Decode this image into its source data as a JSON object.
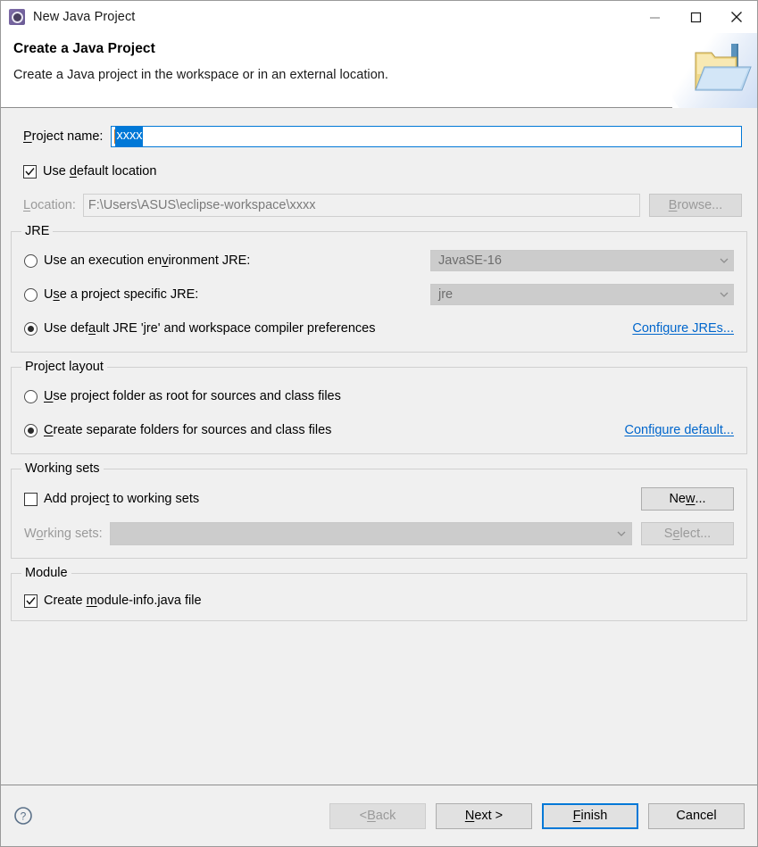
{
  "window": {
    "title": "New Java Project",
    "icon": "eclipse-wizard-icon",
    "minimize_label": "Minimize",
    "maximize_label": "Maximize",
    "close_label": "Close"
  },
  "header": {
    "title": "Create a Java Project",
    "description": "Create a Java project in the workspace or in an external location.",
    "banner_icon": "java-project-folder-icon"
  },
  "project_name": {
    "label": "Project name:",
    "value": "xxxx",
    "selected": true
  },
  "location": {
    "use_default_label": "Use default location",
    "use_default_checked": true,
    "label": "Location:",
    "value": "F:\\Users\\ASUS\\eclipse-workspace\\xxxx",
    "browse_label": "Browse...",
    "browse_enabled": false
  },
  "jre": {
    "legend": "JRE",
    "options": [
      {
        "label": "Use an execution environment JRE:",
        "selected": false,
        "combo_value": "JavaSE-16",
        "combo_enabled": false
      },
      {
        "label": "Use a project specific JRE:",
        "selected": false,
        "combo_value": "jre",
        "combo_enabled": false
      },
      {
        "label": "Use default JRE 'jre' and workspace compiler preferences",
        "selected": true
      }
    ],
    "configure_link": "Configure JREs..."
  },
  "project_layout": {
    "legend": "Project layout",
    "options": [
      {
        "label": "Use project folder as root for sources and class files",
        "selected": false
      },
      {
        "label": "Create separate folders for sources and class files",
        "selected": true
      }
    ],
    "configure_link": "Configure default..."
  },
  "working_sets": {
    "legend": "Working sets",
    "add_label": "Add project to working sets",
    "add_checked": false,
    "new_label": "New...",
    "new_enabled": true,
    "sets_label": "Working sets:",
    "sets_value": "",
    "sets_enabled": false,
    "select_label": "Select...",
    "select_enabled": false
  },
  "module": {
    "legend": "Module",
    "create_label": "Create module-info.java file",
    "create_checked": true
  },
  "footer": {
    "help_icon": "help-icon",
    "buttons": [
      {
        "label": "< Back",
        "enabled": false,
        "focused": false
      },
      {
        "label": "Next >",
        "enabled": true,
        "focused": false
      },
      {
        "label": "Finish",
        "enabled": true,
        "focused": true
      },
      {
        "label": "Cancel",
        "enabled": true,
        "focused": false
      }
    ]
  },
  "colors": {
    "accent": "#0078d7",
    "link": "#0066cc",
    "dialog_bg": "#f0f0f0",
    "header_bg": "#ffffff"
  }
}
